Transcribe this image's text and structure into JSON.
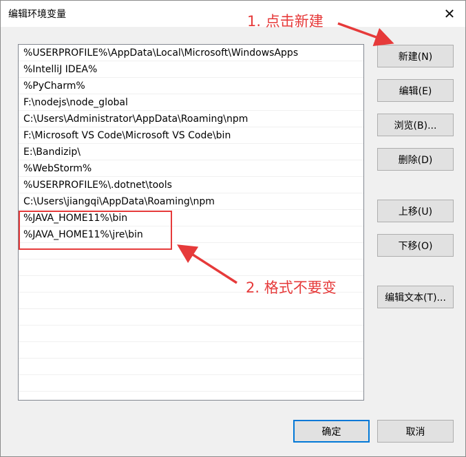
{
  "window": {
    "title": "编辑环境变量",
    "close_glyph": "✕"
  },
  "paths": [
    "%USERPROFILE%\\AppData\\Local\\Microsoft\\WindowsApps",
    "%IntelliJ IDEA%",
    "%PyCharm%",
    "F:\\nodejs\\node_global",
    "C:\\Users\\Administrator\\AppData\\Roaming\\npm",
    "F:\\Microsoft VS Code\\Microsoft VS Code\\bin",
    "E:\\Bandizip\\",
    "%WebStorm%",
    "%USERPROFILE%\\.dotnet\\tools",
    "C:\\Users\\jiangqi\\AppData\\Roaming\\npm",
    "%JAVA_HOME11%\\bin",
    "%JAVA_HOME11%\\jre\\bin",
    "",
    "",
    "",
    "",
    "",
    "",
    "",
    "",
    ""
  ],
  "buttons": {
    "new": "新建(N)",
    "edit": "编辑(E)",
    "browse": "浏览(B)...",
    "delete": "删除(D)",
    "move_up": "上移(U)",
    "move_down": "下移(O)",
    "edit_text": "编辑文本(T)...",
    "ok": "确定",
    "cancel": "取消"
  },
  "annotations": {
    "step1": "1. 点击新建",
    "step2": "2. 格式不要变",
    "color": "#e63a3a"
  }
}
